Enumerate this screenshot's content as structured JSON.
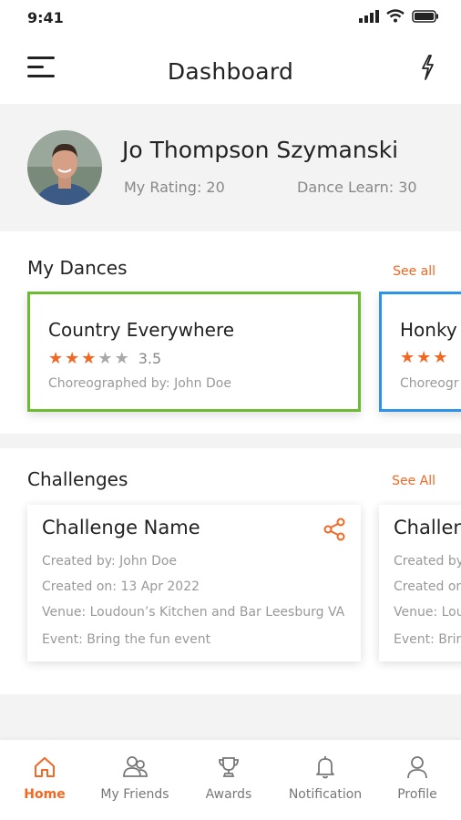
{
  "status": {
    "time": "9:41"
  },
  "header": {
    "title": "Dashboard"
  },
  "profile": {
    "name": "Jo Thompson Szymanski",
    "rating_text": "My Rating: 20",
    "learn_text": "Dance Learn: 30"
  },
  "my_dances": {
    "title": "My Dances",
    "see_all": "See all",
    "cards": [
      {
        "name": "Country Everywhere",
        "rating": "3.5",
        "stars": 3,
        "choreographer": "Choreographed by: John Doe",
        "accent": "#6dbb32"
      },
      {
        "name": "Honky",
        "rating": "",
        "stars": 3,
        "choreographer": "Choreogr",
        "accent": "#2e93e6"
      }
    ]
  },
  "challenges": {
    "title": "Challenges",
    "see_all": "See All",
    "cards": [
      {
        "name": "Challenge Name",
        "created_by": "Created by: John Doe",
        "created_on": "Created on: 13 Apr 2022",
        "venue": "Venue: Loudoun’s Kitchen and Bar Leesburg VA",
        "event": "Event: Bring the fun event"
      },
      {
        "name": "Challen",
        "created_by": "Created by",
        "created_on": "Created on",
        "venue": "Venue: Lou",
        "event": "Event: Brin"
      }
    ]
  },
  "tabs": [
    {
      "label": "Home",
      "icon": "home-icon",
      "active": true
    },
    {
      "label": "My Friends",
      "icon": "friends-icon",
      "active": false
    },
    {
      "label": "Awards",
      "icon": "trophy-icon",
      "active": false
    },
    {
      "label": "Notification",
      "icon": "bell-icon",
      "active": false
    },
    {
      "label": "Profile",
      "icon": "user-icon",
      "active": false
    }
  ],
  "colors": {
    "accent": "#f26722",
    "green": "#6dbb32",
    "blue": "#2e93e6"
  }
}
